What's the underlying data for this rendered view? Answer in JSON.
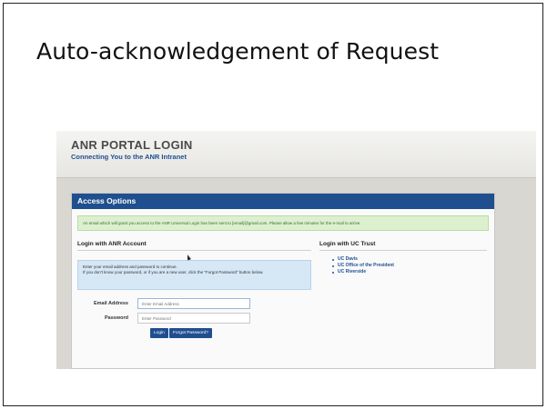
{
  "slide": {
    "title": "Auto-acknowledgement of Request"
  },
  "portal": {
    "title": "ANR PORTAL LOGIN",
    "subtitle": "Connecting You to the ANR Intranet",
    "panel_title": "Access Options",
    "notice": "An email which will grant you access to the ANR Universal Login has been sent to [email]@gmail.com. Please allow a few minutes for the e-mail to arrive.",
    "anr_section": {
      "heading": "Login with ANR Account",
      "info_line1": "Enter your email address and password to continue.",
      "info_line2": "If you don't know your password, or if you are a new user, click the \"Forgot Password\" button below.",
      "email_label": "Email Address",
      "email_placeholder": "Enter Email Address",
      "email_value": "",
      "password_label": "Password",
      "password_placeholder": "Enter Password",
      "login_button": "Login",
      "forgot_button": "Forgot Password?"
    },
    "uc_section": {
      "heading": "Login with UC Trust",
      "links": [
        "UC Davis",
        "UC Office of the President",
        "UC Riverside"
      ]
    },
    "colors": {
      "accent": "#1f4f8f",
      "notice_bg": "#dcf0cf",
      "info_bg": "#d6e7f5"
    }
  }
}
